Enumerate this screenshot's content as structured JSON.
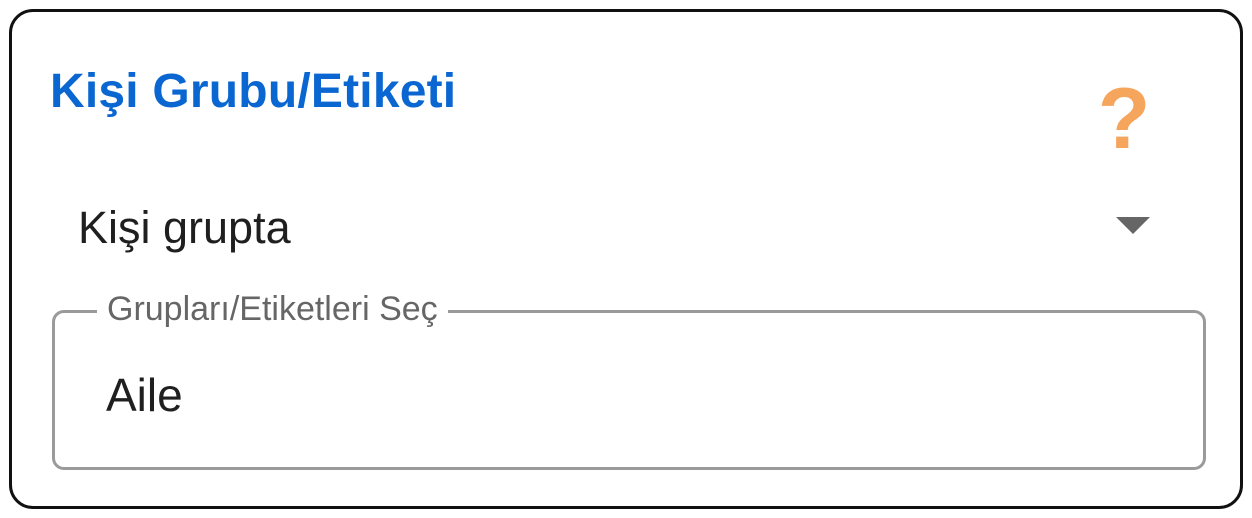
{
  "panel": {
    "title": "Kişi Grubu/Etiketi",
    "help_icon": "question-mark-icon",
    "help_glyph": "?"
  },
  "condition_select": {
    "selected": "Kişi grupta",
    "arrow_icon": "dropdown-arrow-icon"
  },
  "groups_field": {
    "label": "Grupları/Etiketleri Seç",
    "value": "Aile"
  },
  "colors": {
    "title": "#0A66D1",
    "help_icon": "#F6A55D",
    "border": "#111111",
    "field_border": "#9A9A9A",
    "label": "#666666",
    "text": "#1F1F1F"
  }
}
